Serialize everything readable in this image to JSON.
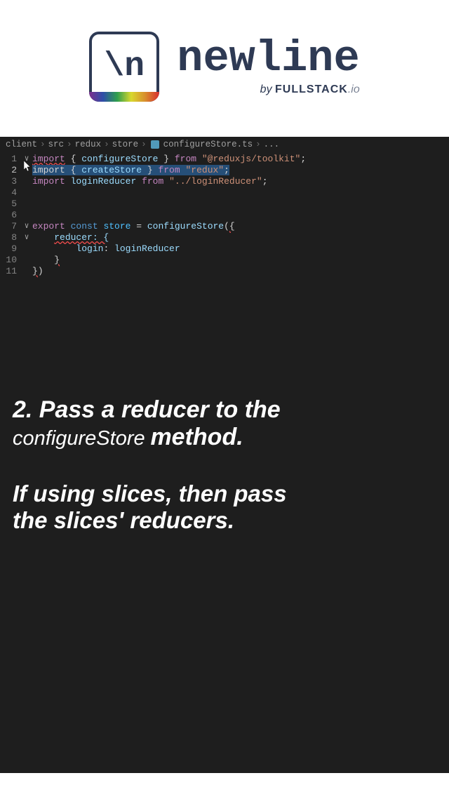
{
  "logo": {
    "symbol": "\\n",
    "brand": "newline",
    "by_prefix": "by ",
    "by_brand": "FULLSTACK",
    "by_suffix": ".io"
  },
  "breadcrumb": {
    "p1": "client",
    "p2": "src",
    "p3": "redux",
    "p4": "store",
    "file": "configureStore.ts",
    "tail": "..."
  },
  "code": {
    "lines": [
      {
        "n": "1",
        "fold": "∨",
        "tokens": [
          {
            "t": "import",
            "c": "kw err-underline"
          },
          {
            "t": " { "
          },
          {
            "t": "configureStore",
            "c": "fn"
          },
          {
            "t": " } "
          },
          {
            "t": "from",
            "c": "kw"
          },
          {
            "t": " "
          },
          {
            "t": "\"@reduxjs/toolkit\"",
            "c": "str"
          },
          {
            "t": ";"
          }
        ]
      },
      {
        "n": "2",
        "fold": "",
        "active": true,
        "tokens": [
          {
            "t": "import { ",
            "c": "selected-bg"
          },
          {
            "t": "createStore",
            "c": "fn selected-bg"
          },
          {
            "t": " } ",
            "c": "selected-bg"
          },
          {
            "t": "from",
            "c": "kw selected-bg"
          },
          {
            "t": " ",
            "c": "selected-bg"
          },
          {
            "t": "\"redux\"",
            "c": "str selected-bg"
          },
          {
            "t": ";",
            "c": "selected-bg"
          }
        ]
      },
      {
        "n": "3",
        "fold": "",
        "tokens": [
          {
            "t": "import",
            "c": "kw"
          },
          {
            "t": " "
          },
          {
            "t": "loginReducer",
            "c": "fn"
          },
          {
            "t": " "
          },
          {
            "t": "from",
            "c": "kw"
          },
          {
            "t": " "
          },
          {
            "t": "\"../loginReducer\"",
            "c": "str"
          },
          {
            "t": ";"
          }
        ]
      },
      {
        "n": "4",
        "fold": "",
        "tokens": []
      },
      {
        "n": "5",
        "fold": "",
        "tokens": []
      },
      {
        "n": "6",
        "fold": "",
        "tokens": []
      },
      {
        "n": "7",
        "fold": "∨",
        "tokens": [
          {
            "t": "export",
            "c": "kw"
          },
          {
            "t": " "
          },
          {
            "t": "const",
            "c": "const"
          },
          {
            "t": " "
          },
          {
            "t": "store",
            "c": "var"
          },
          {
            "t": " = "
          },
          {
            "t": "configureStore",
            "c": "fn"
          },
          {
            "t": "("
          },
          {
            "t": "{",
            "c": "err-underline"
          }
        ]
      },
      {
        "n": "8",
        "fold": "∨",
        "tokens": [
          {
            "t": "    "
          },
          {
            "t": "reducer: {",
            "c": "prop err-underline"
          }
        ]
      },
      {
        "n": "9",
        "fold": "",
        "tokens": [
          {
            "t": "        "
          },
          {
            "t": "login",
            "c": "prop"
          },
          {
            "t": ": "
          },
          {
            "t": "loginReducer",
            "c": "fn"
          }
        ]
      },
      {
        "n": "10",
        "fold": "",
        "tokens": [
          {
            "t": "    "
          },
          {
            "t": "}",
            "c": "err-underline"
          }
        ]
      },
      {
        "n": "11",
        "fold": "",
        "tokens": [
          {
            "t": "}",
            "c": "err-underline"
          },
          {
            "t": ")"
          }
        ]
      }
    ]
  },
  "caption": {
    "step_bold": "2. Pass a reducer to the",
    "step_code": "configureStore",
    "step_bold2": "method.",
    "sub1": "If using slices, then pass",
    "sub2": "the slices' reducers."
  }
}
